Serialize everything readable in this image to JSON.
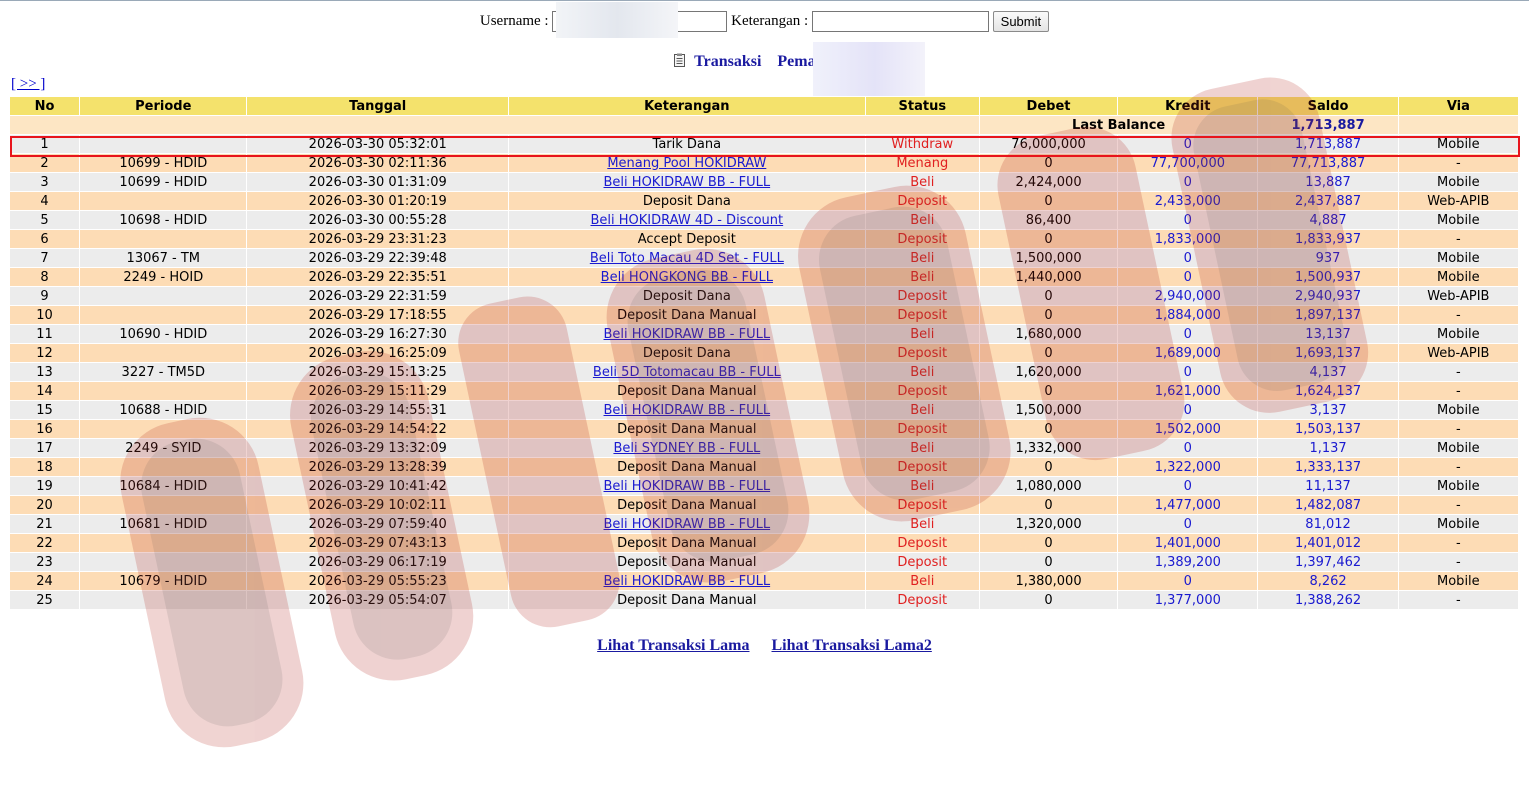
{
  "form": {
    "username_label": "Username :",
    "username_value": "j",
    "keterangan_label": "Keterangan :",
    "keterangan_value": "",
    "submit_label": "Submit"
  },
  "title": {
    "transaksi": "Transaksi",
    "pemain": "Pemain : jo"
  },
  "nav_next": "[ >> ]",
  "table": {
    "headers": [
      "No",
      "Periode",
      "Tanggal",
      "Keterangan",
      "Status",
      "Debet",
      "Kredit",
      "Saldo",
      "Via"
    ],
    "last_balance_label": "Last Balance",
    "last_balance_value": "1,713,887",
    "rows": [
      {
        "no": "1",
        "periode": "",
        "tanggal": "2026-03-30 05:32:01",
        "keterangan": "Tarik Dana",
        "is_link": false,
        "status": "Withdraw",
        "debet": "76,000,000",
        "kredit": "0",
        "saldo": "1,713,887",
        "via": "Mobile"
      },
      {
        "no": "2",
        "periode": "10699 - HDID",
        "tanggal": "2026-03-30 02:11:36",
        "keterangan": "Menang Pool HOKIDRAW",
        "is_link": true,
        "status": "Menang",
        "debet": "0",
        "kredit": "77,700,000",
        "saldo": "77,713,887",
        "via": "-"
      },
      {
        "no": "3",
        "periode": "10699 - HDID",
        "tanggal": "2026-03-30 01:31:09",
        "keterangan": "Beli HOKIDRAW BB - FULL",
        "is_link": true,
        "status": "Beli",
        "debet": "2,424,000",
        "kredit": "0",
        "saldo": "13,887",
        "via": "Mobile"
      },
      {
        "no": "4",
        "periode": "",
        "tanggal": "2026-03-30 01:20:19",
        "keterangan": "Deposit Dana",
        "is_link": false,
        "status": "Deposit",
        "debet": "0",
        "kredit": "2,433,000",
        "saldo": "2,437,887",
        "via": "Web-APIB"
      },
      {
        "no": "5",
        "periode": "10698 - HDID",
        "tanggal": "2026-03-30 00:55:28",
        "keterangan": "Beli HOKIDRAW 4D - Discount",
        "is_link": true,
        "status": "Beli",
        "debet": "86,400",
        "kredit": "0",
        "saldo": "4,887",
        "via": "Mobile"
      },
      {
        "no": "6",
        "periode": "",
        "tanggal": "2026-03-29 23:31:23",
        "keterangan": "Accept Deposit",
        "is_link": false,
        "status": "Deposit",
        "debet": "0",
        "kredit": "1,833,000",
        "saldo": "1,833,937",
        "via": "-"
      },
      {
        "no": "7",
        "periode": "13067 - TM",
        "tanggal": "2026-03-29 22:39:48",
        "keterangan": "Beli Toto Macau 4D Set - FULL",
        "is_link": true,
        "status": "Beli",
        "debet": "1,500,000",
        "kredit": "0",
        "saldo": "937",
        "via": "Mobile"
      },
      {
        "no": "8",
        "periode": "2249 - HOID",
        "tanggal": "2026-03-29 22:35:51",
        "keterangan": "Beli HONGKONG BB - FULL",
        "is_link": true,
        "status": "Beli",
        "debet": "1,440,000",
        "kredit": "0",
        "saldo": "1,500,937",
        "via": "Mobile"
      },
      {
        "no": "9",
        "periode": "",
        "tanggal": "2026-03-29 22:31:59",
        "keterangan": "Deposit Dana",
        "is_link": false,
        "status": "Deposit",
        "debet": "0",
        "kredit": "2,940,000",
        "saldo": "2,940,937",
        "via": "Web-APIB"
      },
      {
        "no": "10",
        "periode": "",
        "tanggal": "2026-03-29 17:18:55",
        "keterangan": "Deposit Dana Manual",
        "is_link": false,
        "status": "Deposit",
        "debet": "0",
        "kredit": "1,884,000",
        "saldo": "1,897,137",
        "via": "-"
      },
      {
        "no": "11",
        "periode": "10690 - HDID",
        "tanggal": "2026-03-29 16:27:30",
        "keterangan": "Beli HOKIDRAW BB - FULL",
        "is_link": true,
        "status": "Beli",
        "debet": "1,680,000",
        "kredit": "0",
        "saldo": "13,137",
        "via": "Mobile"
      },
      {
        "no": "12",
        "periode": "",
        "tanggal": "2026-03-29 16:25:09",
        "keterangan": "Deposit Dana",
        "is_link": false,
        "status": "Deposit",
        "debet": "0",
        "kredit": "1,689,000",
        "saldo": "1,693,137",
        "via": "Web-APIB"
      },
      {
        "no": "13",
        "periode": "3227 - TM5D",
        "tanggal": "2026-03-29 15:13:25",
        "keterangan": "Beli 5D Totomacau BB - FULL",
        "is_link": true,
        "status": "Beli",
        "debet": "1,620,000",
        "kredit": "0",
        "saldo": "4,137",
        "via": "-"
      },
      {
        "no": "14",
        "periode": "",
        "tanggal": "2026-03-29 15:11:29",
        "keterangan": "Deposit Dana Manual",
        "is_link": false,
        "status": "Deposit",
        "debet": "0",
        "kredit": "1,621,000",
        "saldo": "1,624,137",
        "via": "-"
      },
      {
        "no": "15",
        "periode": "10688 - HDID",
        "tanggal": "2026-03-29 14:55:31",
        "keterangan": "Beli HOKIDRAW BB - FULL",
        "is_link": true,
        "status": "Beli",
        "debet": "1,500,000",
        "kredit": "0",
        "saldo": "3,137",
        "via": "Mobile"
      },
      {
        "no": "16",
        "periode": "",
        "tanggal": "2026-03-29 14:54:22",
        "keterangan": "Deposit Dana Manual",
        "is_link": false,
        "status": "Deposit",
        "debet": "0",
        "kredit": "1,502,000",
        "saldo": "1,503,137",
        "via": "-"
      },
      {
        "no": "17",
        "periode": "2249 - SYID",
        "tanggal": "2026-03-29 13:32:09",
        "keterangan": "Beli SYDNEY BB - FULL",
        "is_link": true,
        "status": "Beli",
        "debet": "1,332,000",
        "kredit": "0",
        "saldo": "1,137",
        "via": "Mobile"
      },
      {
        "no": "18",
        "periode": "",
        "tanggal": "2026-03-29 13:28:39",
        "keterangan": "Deposit Dana Manual",
        "is_link": false,
        "status": "Deposit",
        "debet": "0",
        "kredit": "1,322,000",
        "saldo": "1,333,137",
        "via": "-"
      },
      {
        "no": "19",
        "periode": "10684 - HDID",
        "tanggal": "2026-03-29 10:41:42",
        "keterangan": "Beli HOKIDRAW BB - FULL",
        "is_link": true,
        "status": "Beli",
        "debet": "1,080,000",
        "kredit": "0",
        "saldo": "11,137",
        "via": "Mobile"
      },
      {
        "no": "20",
        "periode": "",
        "tanggal": "2026-03-29 10:02:11",
        "keterangan": "Deposit Dana Manual",
        "is_link": false,
        "status": "Deposit",
        "debet": "0",
        "kredit": "1,477,000",
        "saldo": "1,482,087",
        "via": "-"
      },
      {
        "no": "21",
        "periode": "10681 - HDID",
        "tanggal": "2026-03-29 07:59:40",
        "keterangan": "Beli HOKIDRAW BB - FULL",
        "is_link": true,
        "status": "Beli",
        "debet": "1,320,000",
        "kredit": "0",
        "saldo": "81,012",
        "via": "Mobile"
      },
      {
        "no": "22",
        "periode": "",
        "tanggal": "2026-03-29 07:43:13",
        "keterangan": "Deposit Dana Manual",
        "is_link": false,
        "status": "Deposit",
        "debet": "0",
        "kredit": "1,401,000",
        "saldo": "1,401,012",
        "via": "-"
      },
      {
        "no": "23",
        "periode": "",
        "tanggal": "2026-03-29 06:17:19",
        "keterangan": "Deposit Dana Manual",
        "is_link": false,
        "status": "Deposit",
        "debet": "0",
        "kredit": "1,389,200",
        "saldo": "1,397,462",
        "via": "-"
      },
      {
        "no": "24",
        "periode": "10679 - HDID",
        "tanggal": "2026-03-29 05:55:23",
        "keterangan": "Beli HOKIDRAW BB - FULL",
        "is_link": true,
        "status": "Beli",
        "debet": "1,380,000",
        "kredit": "0",
        "saldo": "8,262",
        "via": "Mobile"
      },
      {
        "no": "25",
        "periode": "",
        "tanggal": "2026-03-29 05:54:07",
        "keterangan": "Deposit Dana Manual",
        "is_link": false,
        "status": "Deposit",
        "debet": "0",
        "kredit": "1,377,000",
        "saldo": "1,388,262",
        "via": "-"
      }
    ]
  },
  "footer": {
    "link1": "Lihat Transaksi Lama",
    "link2": "Lihat Transaksi Lama2"
  },
  "colors": {
    "header_bg": "#f4e26c",
    "row_odd": "#ececec",
    "row_even": "#fddcb5",
    "status_red": "#e02020",
    "amount_blue": "#1a1ad0",
    "highlight_border": "#e8141c"
  },
  "icons": {
    "title": "document-icon"
  }
}
